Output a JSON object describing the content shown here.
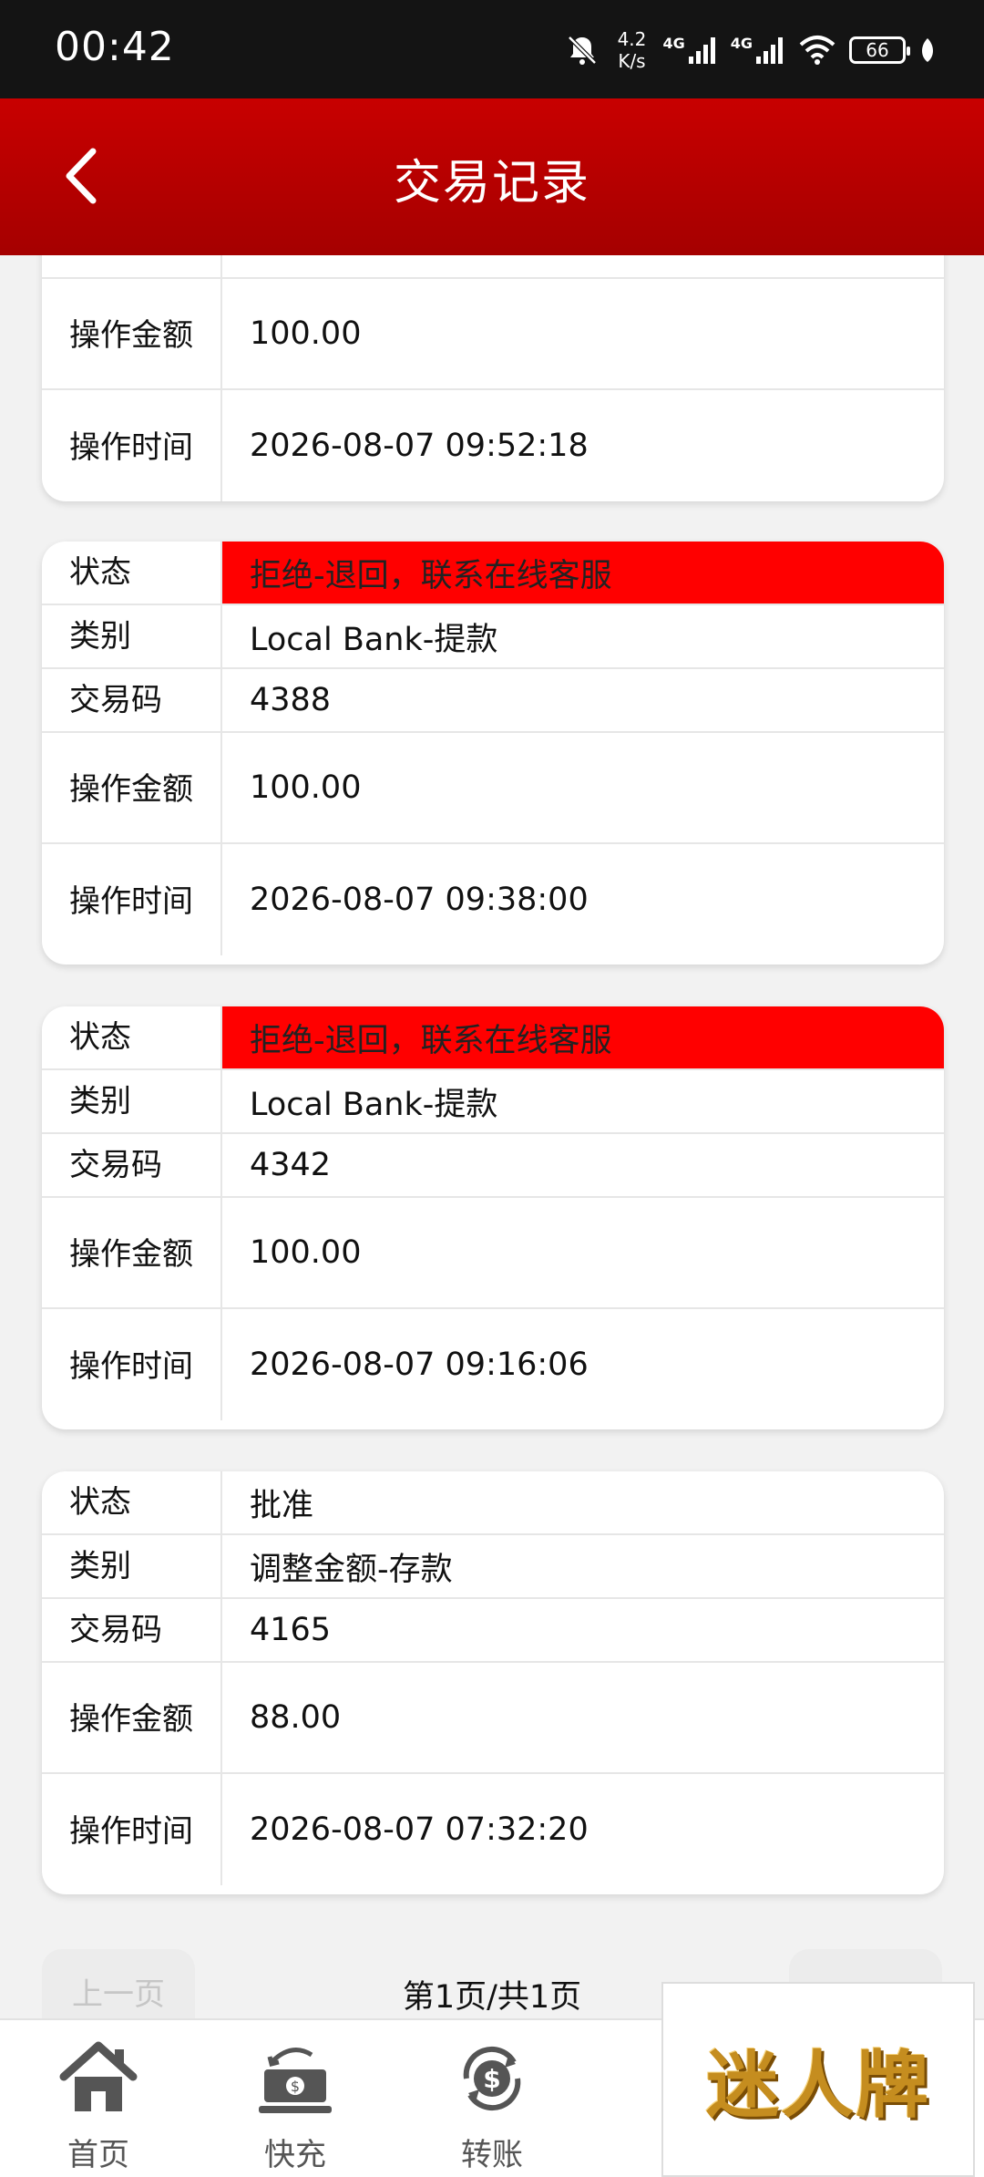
{
  "status_bar": {
    "time": "00:42",
    "net_speed": "4.2",
    "net_unit": "K/s",
    "sig1": "4G",
    "sig2": "4G",
    "battery": "66"
  },
  "header": {
    "title": "交易记录"
  },
  "labels": {
    "status": "状态",
    "category": "类别",
    "code": "交易码",
    "amount": "操作金额",
    "time": "操作时间"
  },
  "records": [
    {
      "amount": "100.00",
      "time": "2026-08-07 09:52:18"
    },
    {
      "status": "拒绝-退回，联系在线客服",
      "category": "Local Bank-提款",
      "code": "4388",
      "amount": "100.00",
      "time": "2026-08-07 09:38:00",
      "status_color": "#ff0000"
    },
    {
      "status": "拒绝-退回，联系在线客服",
      "category": "Local Bank-提款",
      "code": "4342",
      "amount": "100.00",
      "time": "2026-08-07 09:16:06",
      "status_color": "#ff0000"
    },
    {
      "status": "批准",
      "category": "调整金额-存款",
      "code": "4165",
      "amount": "88.00",
      "time": "2026-08-07 07:32:20"
    }
  ],
  "pager": {
    "prev": "上一页",
    "info": "第1页/共1页",
    "next": ""
  },
  "tabbar": [
    {
      "label": "首页",
      "icon": "home-icon"
    },
    {
      "label": "快充",
      "icon": "cash-icon"
    },
    {
      "label": "转账",
      "icon": "dollar-cycle-icon"
    },
    {
      "label": "",
      "icon": "headset-icon"
    }
  ],
  "watermark": "迷人牌",
  "colors": {
    "header": "#b30000",
    "status_reject": "#ff0000"
  }
}
